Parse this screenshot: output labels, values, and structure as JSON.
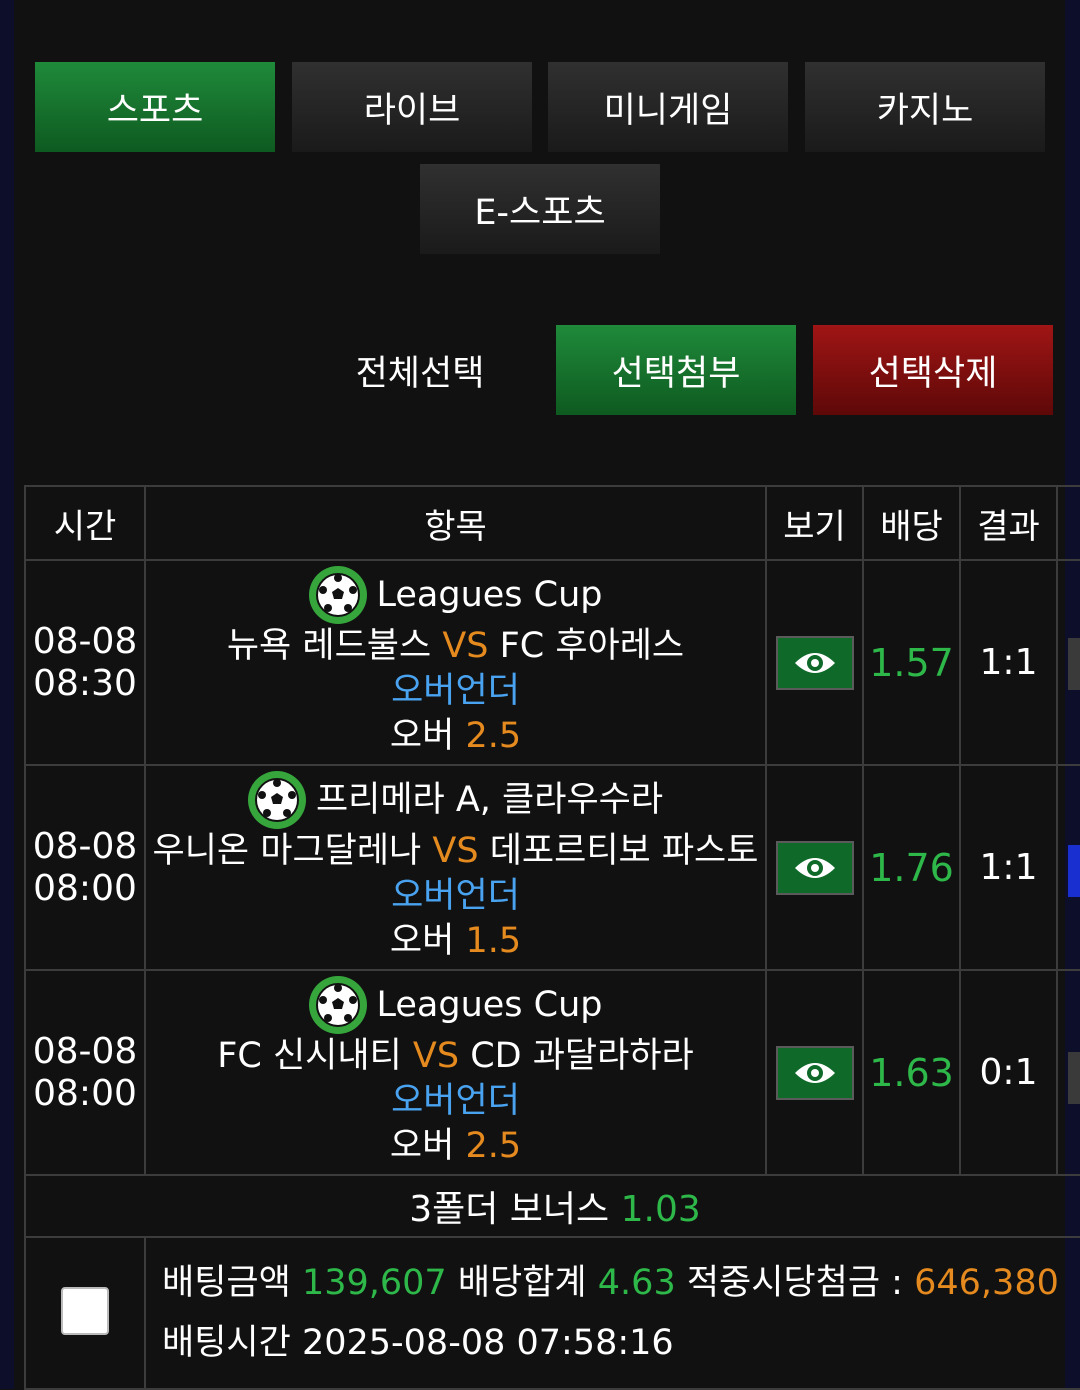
{
  "tabs": [
    "스포츠",
    "라이브",
    "미니게임",
    "카지노",
    "E-스포츠"
  ],
  "actions": {
    "select_all": "전체선택",
    "attach": "선택첨부",
    "delete": "선택삭제"
  },
  "table": {
    "headers": [
      "시간",
      "항목",
      "보기",
      "배당",
      "결과"
    ],
    "rows": [
      {
        "date": "08-08",
        "time": "08:30",
        "league": "Leagues Cup",
        "home": "뉴욕 레드불스",
        "vs": "VS",
        "away": "FC 후아레스",
        "market": "오버언더",
        "pick": "오버",
        "line": "2.5",
        "odds": "1.57",
        "result": "1:1"
      },
      {
        "date": "08-08",
        "time": "08:00",
        "league": "프리메라 A, 클라우수라",
        "home": "우니온 마그달레나",
        "vs": "VS",
        "away": "데포르티보 파스토",
        "market": "오버언더",
        "pick": "오버",
        "line": "1.5",
        "odds": "1.76",
        "result": "1:1"
      },
      {
        "date": "08-08",
        "time": "08:00",
        "league": "Leagues Cup",
        "home": "FC 신시내티",
        "vs": "VS",
        "away": "CD 과달라하라",
        "market": "오버언더",
        "pick": "오버",
        "line": "2.5",
        "odds": "1.63",
        "result": "0:1"
      }
    ],
    "bonus_label": "3폴더 보너스",
    "bonus_value": "1.03"
  },
  "summary": {
    "bet_amount_label": "배팅금액",
    "bet_amount": "139,607",
    "odds_total_label": "배당합계",
    "odds_total": "4.63",
    "payout_label": "적중시당첨금 :",
    "payout": "646,380",
    "bet_time_label": "배팅시간",
    "bet_time": "2025-08-08 07:58:16"
  },
  "colors": {
    "green_button": "#1f8a3a",
    "red_button": "#a01515",
    "odds_green": "#2eb84a",
    "accent_orange": "#e58a1e",
    "market_blue": "#4aa3f0"
  },
  "icons": {
    "sport": "soccer-ball-icon",
    "view": "eye-icon"
  }
}
